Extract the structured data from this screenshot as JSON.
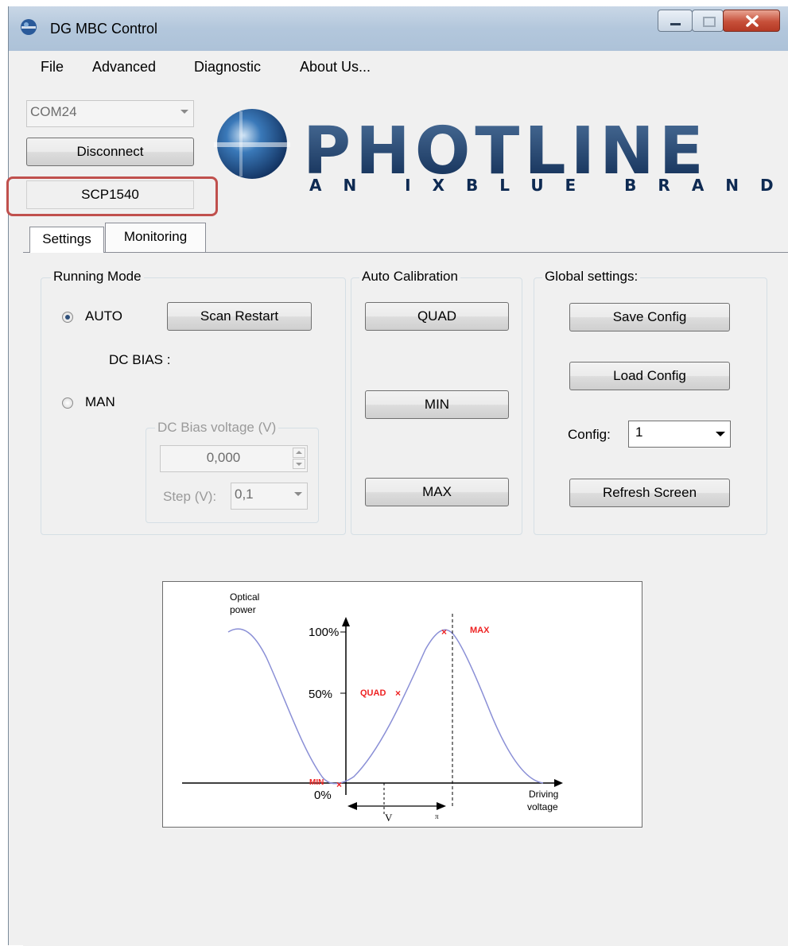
{
  "window": {
    "title": "DG MBC Control"
  },
  "menu": [
    "File",
    "Advanced",
    "Diagnostic",
    "About Us..."
  ],
  "connection": {
    "port": "COM24",
    "disconnect_label": "Disconnect",
    "device": "SCP1540"
  },
  "logo": {
    "name": "PHOTLINE",
    "tagline": "AN IXBLUE BRAND"
  },
  "tabs": [
    "Settings",
    "Monitoring"
  ],
  "running_mode": {
    "title": "Running Mode",
    "auto_label": "AUTO",
    "man_label": "MAN",
    "selected": "AUTO",
    "scan_restart": "Scan Restart",
    "dc_bias_label": "DC BIAS :",
    "dc_bias_group_title": "DC Bias voltage (V)",
    "dc_bias_value": "0,000",
    "step_label": "Step (V):",
    "step_value": "0,1"
  },
  "auto_calibration": {
    "title": "Auto Calibration",
    "quad": "QUAD",
    "min": "MIN",
    "max": "MAX"
  },
  "global_settings": {
    "title": "Global settings:",
    "save": "Save Config",
    "load": "Load Config",
    "config_label": "Config:",
    "config_value": "1",
    "refresh": "Refresh Screen"
  },
  "diagram": {
    "y_title_line1": "Optical",
    "y_title_line2": "power",
    "y_ticks": [
      "100%",
      "50%",
      "0%"
    ],
    "point_max": "MAX",
    "point_quad": "QUAD",
    "point_min": "MIN",
    "x_title_line1": "Driving",
    "x_title_line2": "voltage",
    "v_label": "V",
    "pi_label": "π",
    "curve_color": "#8a8fd6",
    "marker_color": "#ee2222"
  }
}
